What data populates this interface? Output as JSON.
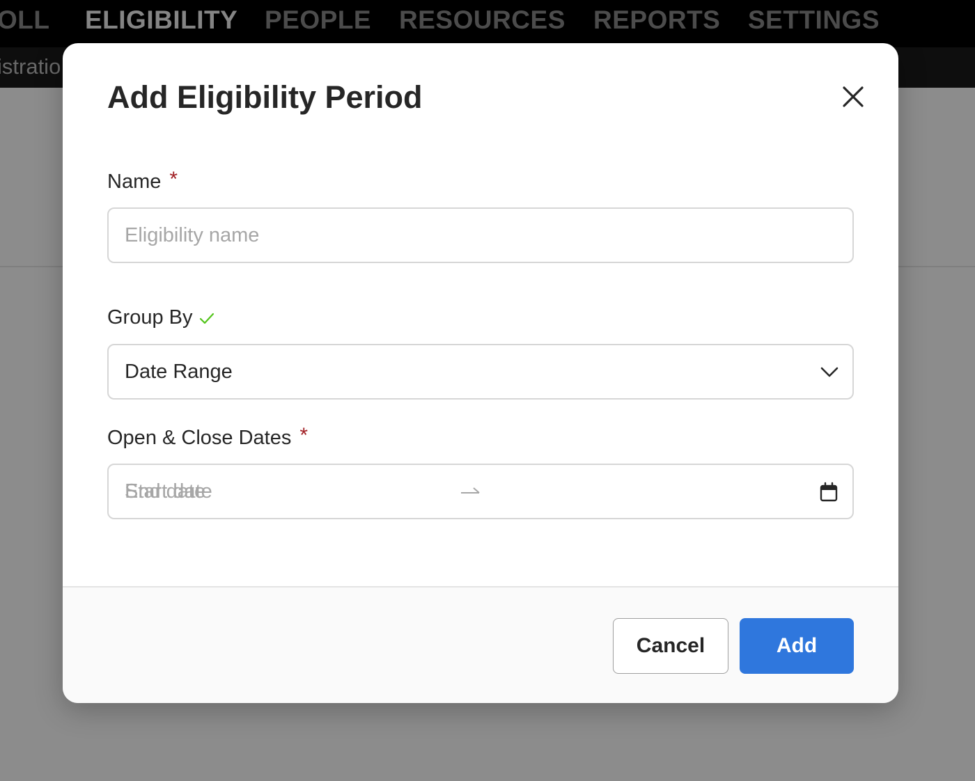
{
  "background": {
    "nav_items": [
      {
        "label": "OLL",
        "active": false
      },
      {
        "label": "ELIGIBILITY",
        "active": true
      },
      {
        "label": "PEOPLE",
        "active": false
      },
      {
        "label": "RESOURCES",
        "active": false
      },
      {
        "label": "REPORTS",
        "active": false
      },
      {
        "label": "SETTINGS",
        "active": false
      }
    ],
    "subnav_label": "istratio"
  },
  "modal": {
    "title": "Add Eligibility Period",
    "close_icon": "close-icon",
    "name_field": {
      "label": "Name",
      "required_mark": "*",
      "placeholder": "Eligibility name",
      "value": ""
    },
    "group_by_field": {
      "label": "Group By",
      "status_icon": "check-icon",
      "selected": "Date Range"
    },
    "dates_field": {
      "label": "Open & Close Dates",
      "required_mark": "*",
      "start_placeholder": "Start date",
      "end_placeholder": "End date",
      "separator_icon": "arrow-right-icon",
      "picker_icon": "calendar-icon"
    },
    "footer": {
      "cancel_label": "Cancel",
      "add_label": "Add"
    }
  },
  "colors": {
    "primary": "#2f77dd",
    "required": "#a11f24",
    "valid": "#52c41a",
    "nav_background": "#000000"
  }
}
